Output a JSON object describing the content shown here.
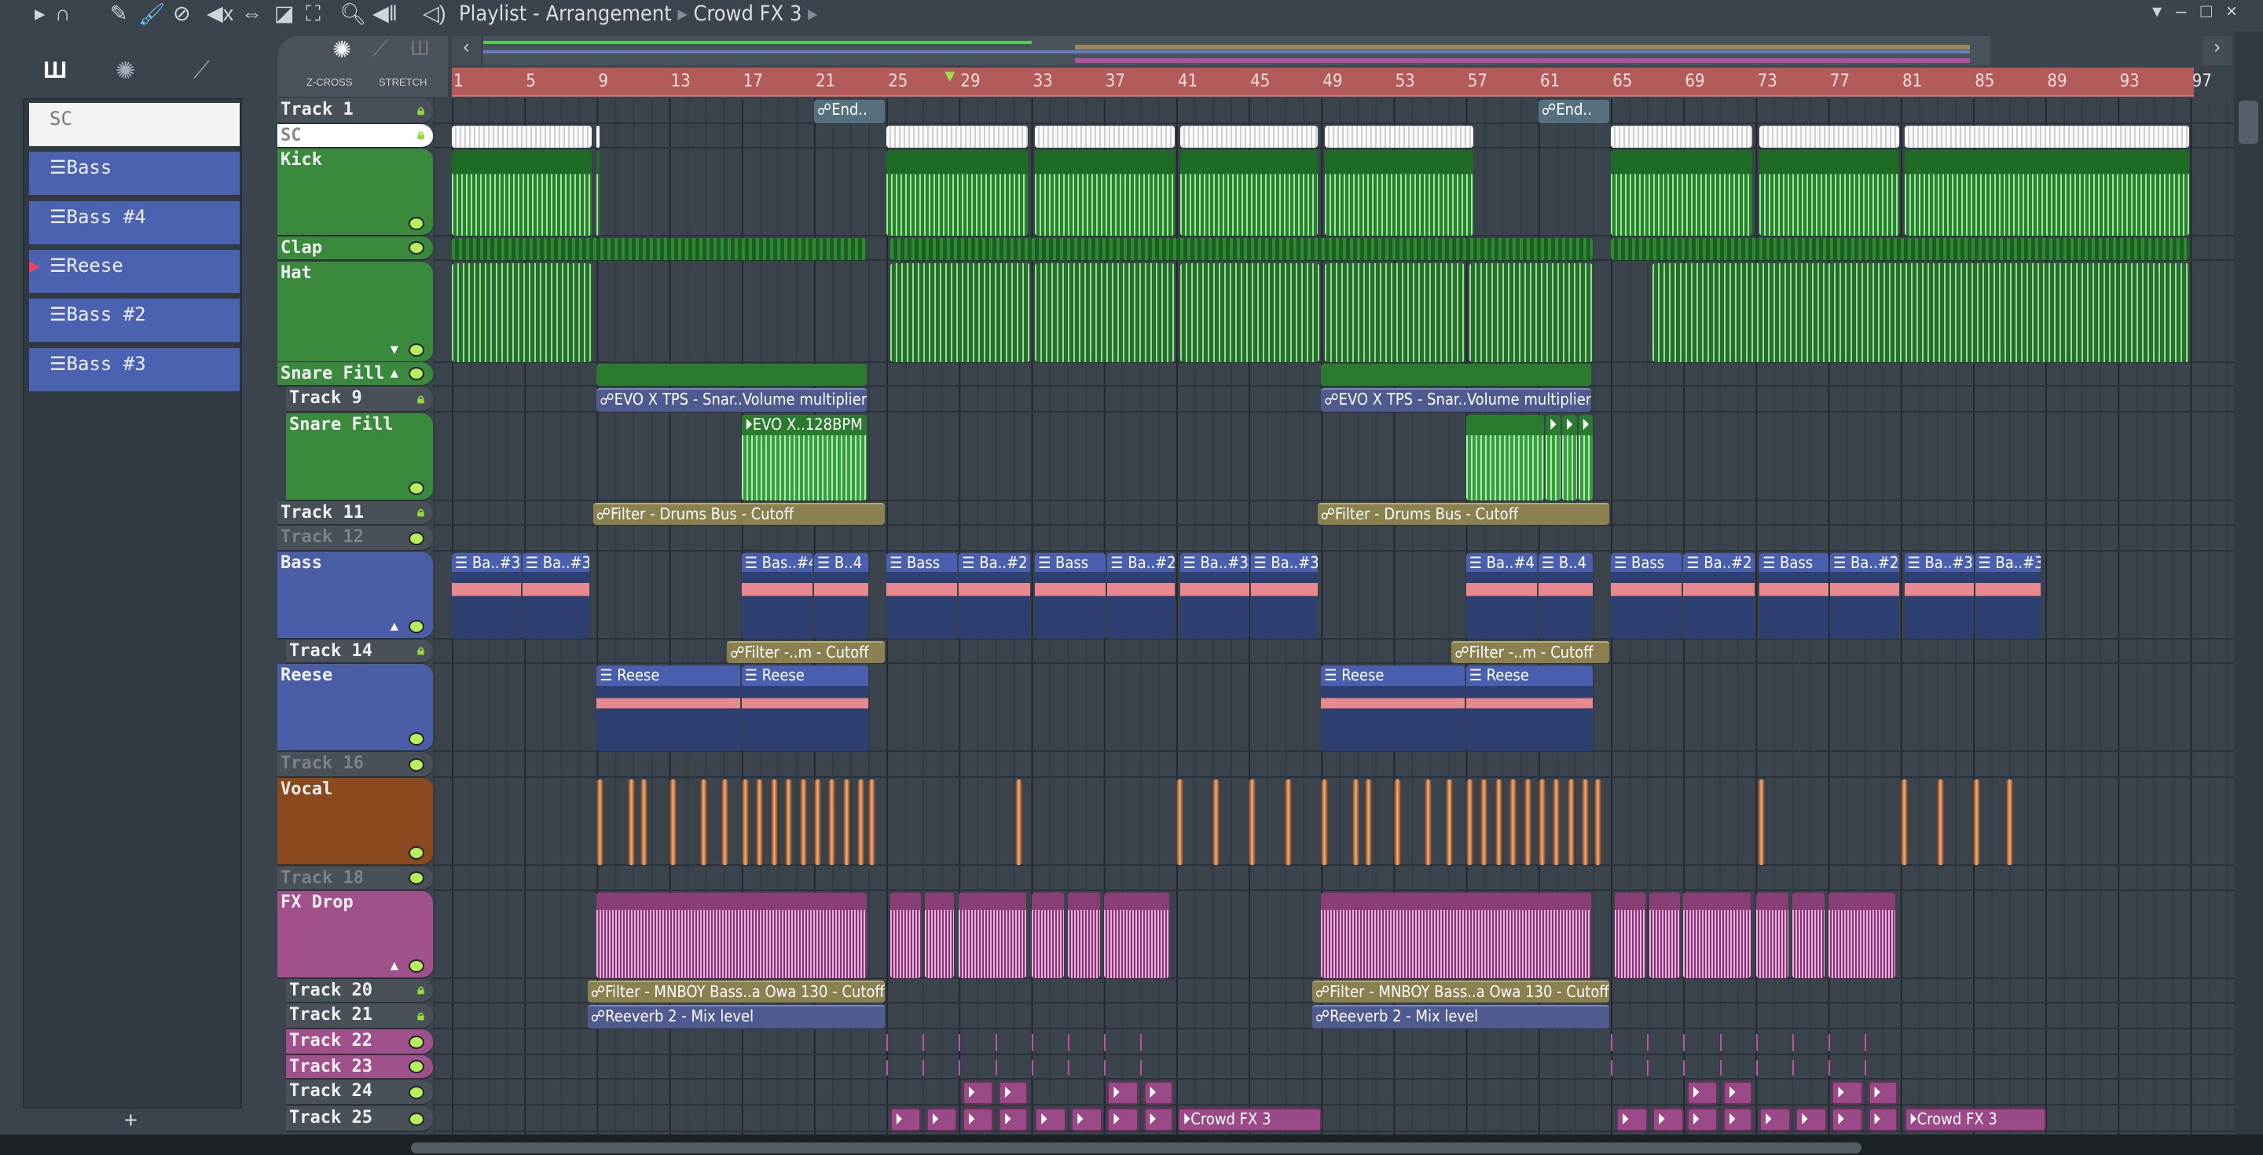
{
  "toolbar": {
    "title": "Playlist - Arrangement",
    "separator": "▸",
    "current": "Crowd FX 3",
    "icons": [
      "play-arrow-icon",
      "magnet-icon",
      "pencil-icon",
      "paint-brush-icon",
      "delete-icon",
      "mute-icon",
      "slip-icon",
      "slice-icon",
      "select-icon",
      "zoom-icon",
      "playback-icon",
      "speaker-icon"
    ]
  },
  "window": {
    "buttons": [
      "▾",
      "–",
      "□",
      "×"
    ]
  },
  "picker": {
    "tabs": [
      "piano-icon",
      "audio-icon",
      "automation-icon"
    ],
    "items": [
      "SC",
      "Bass",
      "Bass #4",
      "Reese",
      "Bass #2",
      "Bass #3"
    ],
    "add": "+"
  },
  "header": {
    "zcross": "Z-CROSS",
    "stretch": "STRETCH"
  },
  "ruler": {
    "labels": [
      "1",
      "5",
      "9",
      "13",
      "17",
      "21",
      "25",
      "29",
      "33",
      "37",
      "41",
      "45",
      "49",
      "53",
      "57",
      "61",
      "65",
      "69",
      "73",
      "77",
      "81",
      "85",
      "89",
      "93",
      "97"
    ],
    "playhead_bar": 28.5
  },
  "tracks": [
    {
      "name": "Track 1",
      "color": "#4a5058",
      "lock": true,
      "clips": [
        {
          "s": 21,
          "l": 4,
          "k": "autoteal",
          "t": "☍End.."
        },
        {
          "s": 61,
          "l": 4,
          "k": "autoteal",
          "t": "☍End.."
        }
      ]
    },
    {
      "name": "SC",
      "color": "#ffffff",
      "lock": true,
      "clips": [
        {
          "s": 1,
          "l": 7.8,
          "k": "white"
        },
        {
          "s": 9,
          "l": 0.25,
          "k": "white"
        },
        {
          "s": 25,
          "l": 7.9,
          "k": "white"
        },
        {
          "s": 33.2,
          "l": 7.8,
          "k": "white"
        },
        {
          "s": 41.2,
          "l": 7.7,
          "k": "white"
        },
        {
          "s": 49.2,
          "l": 8.3,
          "k": "white"
        },
        {
          "s": 65,
          "l": 7.9,
          "k": "white"
        },
        {
          "s": 73.2,
          "l": 7.8,
          "k": "white"
        },
        {
          "s": 81.2,
          "l": 15.8,
          "k": "white"
        }
      ]
    },
    {
      "name": "Kick",
      "color": "#3a8a3e",
      "clips": [
        {
          "s": 1,
          "l": 7.8,
          "k": "kick"
        },
        {
          "s": 9,
          "l": 0.25,
          "k": "kick"
        },
        {
          "s": 25,
          "l": 7.9,
          "k": "kick"
        },
        {
          "s": 33.2,
          "l": 7.8,
          "k": "kick"
        },
        {
          "s": 41.2,
          "l": 7.7,
          "k": "kick"
        },
        {
          "s": 49.2,
          "l": 8.3,
          "k": "kick"
        },
        {
          "s": 65,
          "l": 7.9,
          "k": "kick"
        },
        {
          "s": 73.2,
          "l": 7.8,
          "k": "kick"
        },
        {
          "s": 81.2,
          "l": 15.8,
          "k": "kick"
        }
      ]
    },
    {
      "name": "Clap",
      "color": "#3a8a3e",
      "clips": [
        {
          "s": 1,
          "l": 23,
          "k": "green"
        },
        {
          "s": 25.2,
          "l": 38.9,
          "k": "green"
        },
        {
          "s": 65,
          "l": 32,
          "k": "green"
        }
      ]
    },
    {
      "name": "Hat",
      "color": "#3a8a3e",
      "arrow": "▼",
      "clips": [
        {
          "s": 1,
          "l": 7.8,
          "k": "hat"
        },
        {
          "s": 25.2,
          "l": 7.8,
          "k": "hat"
        },
        {
          "s": 33.2,
          "l": 7.8,
          "k": "hat"
        },
        {
          "s": 41.2,
          "l": 7.8,
          "k": "hat"
        },
        {
          "s": 49.2,
          "l": 7.8,
          "k": "hat"
        },
        {
          "s": 57.2,
          "l": 6.9,
          "k": "hat"
        },
        {
          "s": 67.3,
          "l": 29.7,
          "k": "hat"
        }
      ]
    },
    {
      "name": "Snare Fill",
      "color": "#3a8a3e",
      "arrow": "▲",
      "clips": [
        {
          "s": 9,
          "l": 15,
          "k": "bar"
        },
        {
          "s": 49,
          "l": 15,
          "k": "bar"
        }
      ]
    },
    {
      "name": "Track 9",
      "color": "#4a5058",
      "lock": true,
      "sub": true,
      "clips": [
        {
          "s": 9,
          "l": 15,
          "k": "autoblue",
          "t": "☍EVO X TPS - Snar..Volume multiplier"
        },
        {
          "s": 49,
          "l": 15,
          "k": "autoblue",
          "t": "☍EVO X TPS - Snar..Volume multiplier"
        }
      ]
    },
    {
      "name": "Snare Fill",
      "color": "#3a8a3e",
      "sub": true,
      "clips": [
        {
          "s": 17,
          "l": 7,
          "k": "audio",
          "t": "⏵EVO X..128BPM"
        },
        {
          "s": 57,
          "l": 4.4,
          "k": "audio"
        },
        {
          "s": 61.4,
          "l": 0.9,
          "k": "audio",
          "t": "⏵"
        },
        {
          "s": 62.3,
          "l": 0.9,
          "k": "audio",
          "t": "⏵"
        },
        {
          "s": 63.2,
          "l": 0.9,
          "k": "audio",
          "t": "⏵"
        }
      ]
    },
    {
      "name": "Track 11",
      "color": "#4a5058",
      "lock": true,
      "clips": [
        {
          "s": 8.8,
          "l": 16.2,
          "k": "autotan",
          "t": "☍Filter - Drums Bus - Cutoff"
        },
        {
          "s": 48.8,
          "l": 16.2,
          "k": "autotan",
          "t": "☍Filter - Drums Bus - Cutoff"
        }
      ]
    },
    {
      "name": "Track 12",
      "color": "#4a5058",
      "dim": true,
      "clips": []
    },
    {
      "name": "Bass",
      "color": "#4a5ea8",
      "arrow": "▲",
      "clips": [
        {
          "s": 1,
          "l": 3.9,
          "k": "pattern",
          "t": "☰ Ba..#3"
        },
        {
          "s": 4.9,
          "l": 3.8,
          "k": "pattern",
          "t": "☰ Ba..#3"
        },
        {
          "s": 17,
          "l": 4,
          "k": "pattern",
          "t": "☰ Bas..#4"
        },
        {
          "s": 21,
          "l": 3.1,
          "k": "pattern",
          "t": "☰ B..4"
        },
        {
          "s": 25,
          "l": 4,
          "k": "pattern",
          "t": "☰ Bass"
        },
        {
          "s": 29,
          "l": 4,
          "k": "pattern",
          "t": "☰ Ba..#2"
        },
        {
          "s": 33.2,
          "l": 4,
          "k": "pattern",
          "t": "☰ Bass"
        },
        {
          "s": 37.2,
          "l": 3.8,
          "k": "pattern",
          "t": "☰ Ba..#2"
        },
        {
          "s": 41.2,
          "l": 3.9,
          "k": "pattern",
          "t": "☰ Ba..#3"
        },
        {
          "s": 45.1,
          "l": 3.8,
          "k": "pattern",
          "t": "☰ Ba..#3"
        },
        {
          "s": 57,
          "l": 4,
          "k": "pattern",
          "t": "☰ Ba..#4"
        },
        {
          "s": 61,
          "l": 3.1,
          "k": "pattern",
          "t": "☰ B..4"
        },
        {
          "s": 65,
          "l": 4,
          "k": "pattern",
          "t": "☰ Bass"
        },
        {
          "s": 69,
          "l": 4,
          "k": "pattern",
          "t": "☰ Ba..#2"
        },
        {
          "s": 73.2,
          "l": 3.9,
          "k": "pattern",
          "t": "☰ Bass"
        },
        {
          "s": 77.1,
          "l": 3.9,
          "k": "pattern",
          "t": "☰ Ba..#2"
        },
        {
          "s": 81.2,
          "l": 3.9,
          "k": "pattern",
          "t": "☰ Ba..#3"
        },
        {
          "s": 85.1,
          "l": 3.7,
          "k": "pattern",
          "t": "☰ Ba..#3"
        }
      ]
    },
    {
      "name": "Track 14",
      "color": "#4a5058",
      "lock": true,
      "sub": true,
      "clips": [
        {
          "s": 16.2,
          "l": 8.8,
          "k": "autotan",
          "t": "☍Filter -..m - Cutoff"
        },
        {
          "s": 56.2,
          "l": 8.8,
          "k": "autotan",
          "t": "☍Filter -..m - Cutoff"
        }
      ]
    },
    {
      "name": "Reese",
      "color": "#4a5ea8",
      "clips": [
        {
          "s": 9,
          "l": 8,
          "k": "reese",
          "t": "☰ Reese"
        },
        {
          "s": 17,
          "l": 7.1,
          "k": "reese",
          "t": "☰ Reese"
        },
        {
          "s": 49,
          "l": 8,
          "k": "reese",
          "t": "☰ Reese"
        },
        {
          "s": 57,
          "l": 7.1,
          "k": "reese",
          "t": "☰ Reese"
        }
      ]
    },
    {
      "name": "Track 16",
      "color": "#4a5058",
      "dim": true,
      "clips": []
    },
    {
      "name": "Vocal",
      "color": "#8a4a1e",
      "vocal": [
        9,
        10.7,
        11.4,
        13,
        14.7,
        15.9,
        17,
        17.8,
        18.6,
        19.4,
        20.2,
        21,
        21.8,
        22.6,
        23.4,
        24,
        32.1,
        41,
        43,
        45,
        47,
        49,
        50.7,
        51.4,
        53,
        54.7,
        55.9,
        57,
        57.8,
        58.6,
        59.4,
        60.2,
        61,
        61.8,
        62.6,
        63.4,
        64.1,
        73.1,
        81,
        83,
        85,
        86.8
      ]
    },
    {
      "name": "Track 18",
      "color": "#4a5058",
      "dim": true,
      "clips": []
    },
    {
      "name": "FX Drop",
      "color": "#a0508a",
      "arrow": "▲",
      "clips": [
        {
          "s": 9,
          "l": 15,
          "k": "fx"
        },
        {
          "s": 25.2,
          "l": 1.8,
          "k": "fx"
        },
        {
          "s": 27.1,
          "l": 1.7,
          "k": "fx"
        },
        {
          "s": 29,
          "l": 3.8,
          "k": "fx"
        },
        {
          "s": 33,
          "l": 1.9,
          "k": "fx"
        },
        {
          "s": 35,
          "l": 1.9,
          "k": "fx"
        },
        {
          "s": 37,
          "l": 3.7,
          "k": "fx"
        },
        {
          "s": 49,
          "l": 15,
          "k": "fx"
        },
        {
          "s": 65.2,
          "l": 1.8,
          "k": "fx"
        },
        {
          "s": 67.1,
          "l": 1.8,
          "k": "fx"
        },
        {
          "s": 69,
          "l": 3.8,
          "k": "fx"
        },
        {
          "s": 73,
          "l": 1.9,
          "k": "fx"
        },
        {
          "s": 75,
          "l": 1.9,
          "k": "fx"
        },
        {
          "s": 77,
          "l": 3.8,
          "k": "fx"
        }
      ]
    },
    {
      "name": "Track 20",
      "color": "#4a5058",
      "lock": true,
      "sub": true,
      "clips": [
        {
          "s": 8.5,
          "l": 16.5,
          "k": "autotan",
          "t": "☍Filter - MNBOY Bass..a Owa 130 - Cutoff"
        },
        {
          "s": 48.5,
          "l": 16.5,
          "k": "autotan",
          "t": "☍Filter - MNBOY Bass..a Owa 130 - Cutoff"
        }
      ]
    },
    {
      "name": "Track 21",
      "color": "#4a5058",
      "lock": true,
      "sub": true,
      "clips": [
        {
          "s": 8.5,
          "l": 16.5,
          "k": "autoblue",
          "t": "☍Reeverb 2 - Mix level"
        },
        {
          "s": 48.5,
          "l": 16.5,
          "k": "autoblue",
          "t": "☍Reeverb 2 - Mix level"
        }
      ]
    },
    {
      "name": "Track 22",
      "color": "#a0508a",
      "sub": true,
      "markers": [
        25,
        27,
        29,
        31,
        33,
        35,
        37,
        39,
        65,
        67,
        69,
        71,
        73,
        75,
        77,
        79
      ]
    },
    {
      "name": "Track 23",
      "color": "#a0508a",
      "sub": true,
      "markers": [
        25,
        27,
        29,
        31,
        33,
        35,
        37,
        39,
        65,
        67,
        69,
        71,
        73,
        75,
        77,
        79
      ]
    },
    {
      "name": "Track 24",
      "color": "#4a5058",
      "sub": true,
      "clips": [
        {
          "s": 29.2,
          "l": 1.8,
          "k": "pink",
          "t": "⏵"
        },
        {
          "s": 31.2,
          "l": 1.7,
          "k": "pink",
          "t": "⏵"
        },
        {
          "s": 37.2,
          "l": 1.8,
          "k": "pink",
          "t": "⏵"
        },
        {
          "s": 39.2,
          "l": 1.7,
          "k": "pink",
          "t": "⏵"
        },
        {
          "s": 69.2,
          "l": 1.8,
          "k": "pink",
          "t": "⏵"
        },
        {
          "s": 71.2,
          "l": 1.7,
          "k": "pink",
          "t": "⏵"
        },
        {
          "s": 77.2,
          "l": 1.8,
          "k": "pink",
          "t": "⏵"
        },
        {
          "s": 79.2,
          "l": 1.7,
          "k": "pink",
          "t": "⏵"
        }
      ]
    },
    {
      "name": "Track 25",
      "color": "#4a5058",
      "sub": true,
      "clips": [
        {
          "s": 25.2,
          "l": 1.8,
          "k": "pink",
          "t": "⏵"
        },
        {
          "s": 27.2,
          "l": 1.8,
          "k": "pink",
          "t": "⏵"
        },
        {
          "s": 29.2,
          "l": 1.8,
          "k": "pink",
          "t": "⏵"
        },
        {
          "s": 31.2,
          "l": 1.7,
          "k": "pink",
          "t": "⏵"
        },
        {
          "s": 33.2,
          "l": 1.8,
          "k": "pink",
          "t": "⏵"
        },
        {
          "s": 35.2,
          "l": 1.8,
          "k": "pink",
          "t": "⏵"
        },
        {
          "s": 37.2,
          "l": 1.8,
          "k": "pink",
          "t": "⏵"
        },
        {
          "s": 39.2,
          "l": 1.7,
          "k": "pink",
          "t": "⏵"
        },
        {
          "s": 41.1,
          "l": 8,
          "k": "pink",
          "t": "⏵Crowd FX 3"
        },
        {
          "s": 65.3,
          "l": 1.8,
          "k": "pink",
          "t": "⏵"
        },
        {
          "s": 67.3,
          "l": 1.8,
          "k": "pink",
          "t": "⏵"
        },
        {
          "s": 69.2,
          "l": 1.8,
          "k": "pink",
          "t": "⏵"
        },
        {
          "s": 71.2,
          "l": 1.7,
          "k": "pink",
          "t": "⏵"
        },
        {
          "s": 73.2,
          "l": 1.8,
          "k": "pink",
          "t": "⏵"
        },
        {
          "s": 75.2,
          "l": 1.8,
          "k": "pink",
          "t": "⏵"
        },
        {
          "s": 77.2,
          "l": 1.8,
          "k": "pink",
          "t": "⏵"
        },
        {
          "s": 79.2,
          "l": 1.7,
          "k": "pink",
          "t": "⏵"
        },
        {
          "s": 81.2,
          "l": 7.9,
          "k": "pink",
          "t": "⏵Crowd FX 3"
        }
      ]
    }
  ]
}
